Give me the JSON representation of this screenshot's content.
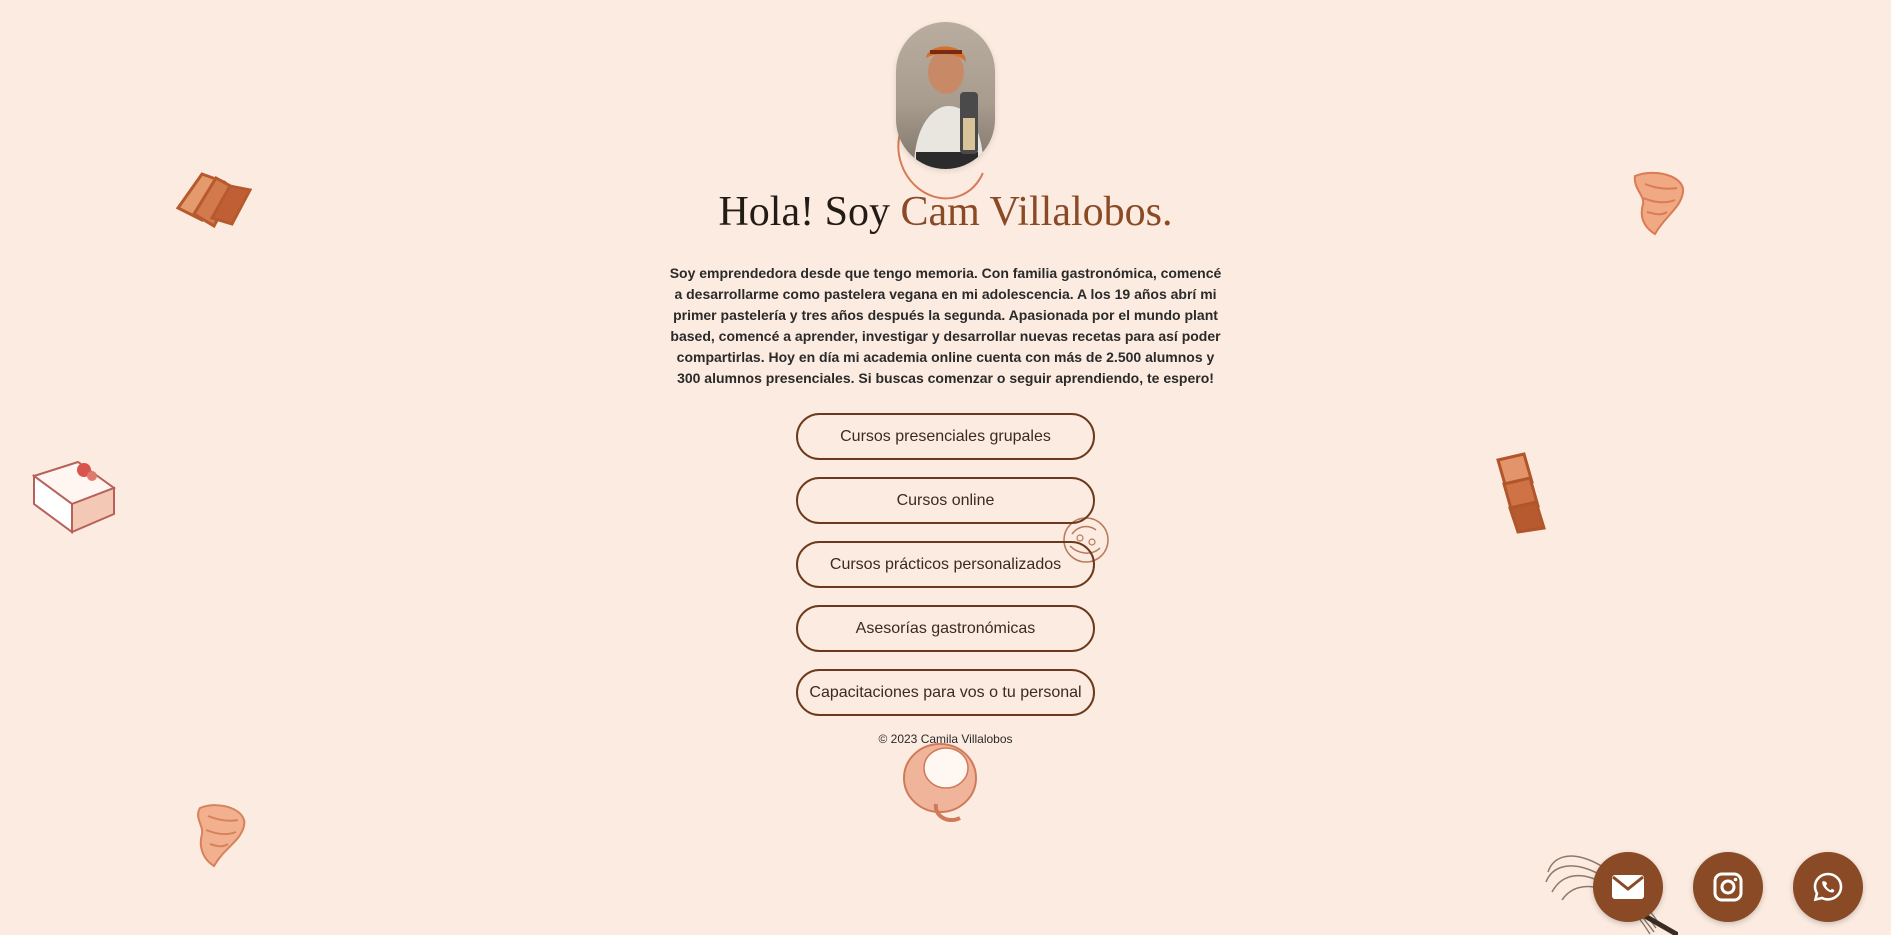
{
  "profile": {
    "avatar_alt": "Cam Villalobos"
  },
  "hero": {
    "title_prefix": "Hola! Soy ",
    "title_name": "Cam Villalobos.",
    "bio": "Soy emprendedora desde que tengo memoria. Con familia gastronómica, comencé a desarrollarme como pastelera vegana en mi adolescencia. A los 19 años abrí mi primer pastelería y tres años después la segunda. Apasionada por el mundo plant based, comencé a aprender, investigar y desarrollar nuevas recetas para así poder compartirlas. Hoy en día mi academia online cuenta con más de 2.500 alumnos y 300 alumnos presenciales. Si buscas comenzar o seguir aprendiendo, te espero!"
  },
  "links": [
    {
      "label": "Cursos presenciales grupales"
    },
    {
      "label": "Cursos online"
    },
    {
      "label": "Cursos prácticos personalizados"
    },
    {
      "label": "Asesorías gastronómicas"
    },
    {
      "label": "Capacitaciones para vos o tu personal"
    }
  ],
  "footer": {
    "copyright": "© 2023 Camila Villalobos"
  },
  "social": [
    {
      "icon": "envelope-icon"
    },
    {
      "icon": "instagram-icon"
    },
    {
      "icon": "whatsapp-icon"
    }
  ],
  "colors": {
    "background": "#fcebe0",
    "accent": "#8a4a26",
    "button_border": "#6b3a1c"
  }
}
